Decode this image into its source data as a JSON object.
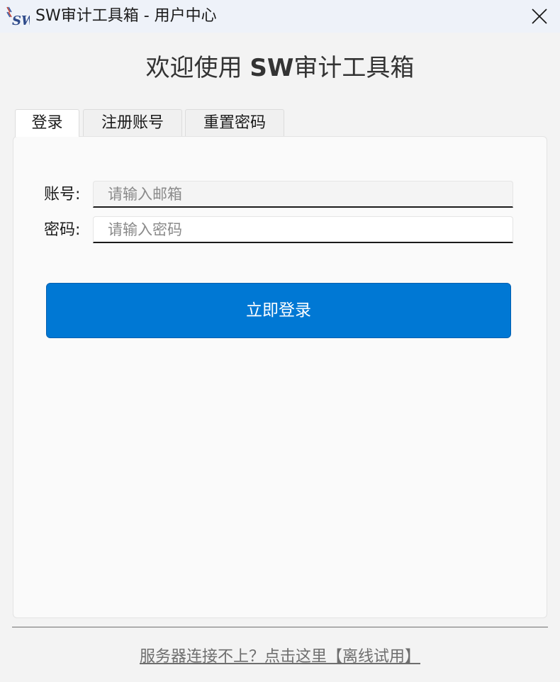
{
  "window": {
    "title": "SW审计工具箱 - 用户中心",
    "close_label": "×"
  },
  "logo": {
    "text": "SW"
  },
  "heading": {
    "prefix": "欢迎使用 ",
    "brand": "SW",
    "suffix": "审计工具箱"
  },
  "tabs": [
    {
      "label": "登录",
      "active": true
    },
    {
      "label": "注册账号",
      "active": false
    },
    {
      "label": "重置密码",
      "active": false
    }
  ],
  "form": {
    "account_label": "账号:",
    "account_placeholder": "请输入邮箱",
    "password_label": "密码:",
    "password_placeholder": "请输入密码",
    "submit_label": "立即登录"
  },
  "footer": {
    "offline_link": "服务器连接不上？点击这里【离线试用】"
  },
  "colors": {
    "accent": "#0078d4",
    "titlebar_bg": "#eef2f9",
    "window_bg": "#f3f3f3"
  }
}
